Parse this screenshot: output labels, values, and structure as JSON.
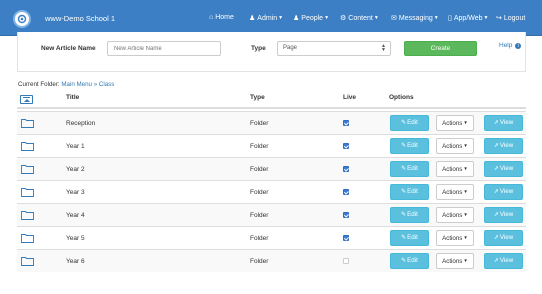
{
  "navbar": {
    "brand": "www-Demo School 1",
    "items": [
      {
        "icon": "home-icon",
        "glyph": "⌂",
        "label": "Home",
        "caret": false
      },
      {
        "icon": "user-icon",
        "glyph": "♟",
        "label": "Admin",
        "caret": true
      },
      {
        "icon": "users-icon",
        "glyph": "♟",
        "label": "People",
        "caret": true
      },
      {
        "icon": "gear-icon",
        "glyph": "⚙",
        "label": "Content",
        "caret": true
      },
      {
        "icon": "envelope-icon",
        "glyph": "✉",
        "label": "Messaging",
        "caret": true
      },
      {
        "icon": "mobile-icon",
        "glyph": "▯",
        "label": "App/Web",
        "caret": true
      },
      {
        "icon": "logout-icon",
        "glyph": "↪",
        "label": "Logout",
        "caret": false
      }
    ]
  },
  "create_panel": {
    "name_label": "New Article Name",
    "name_placeholder": "New Article Name",
    "type_label": "Type",
    "type_value": "Page",
    "create_label": "Create",
    "help_label": "Help"
  },
  "breadcrumb": {
    "prefix": "Current Folder:",
    "items": [
      "Main Menu",
      "Class"
    ],
    "separator": "»"
  },
  "table": {
    "headers": {
      "title": "Title",
      "type": "Type",
      "live": "Live",
      "options": "Options"
    },
    "rows": [
      {
        "title": "Reception",
        "type": "Folder",
        "live": true
      },
      {
        "title": "Year 1",
        "type": "Folder",
        "live": true
      },
      {
        "title": "Year 2",
        "type": "Folder",
        "live": true
      },
      {
        "title": "Year 3",
        "type": "Folder",
        "live": true
      },
      {
        "title": "Year 4",
        "type": "Folder",
        "live": true
      },
      {
        "title": "Year 5",
        "type": "Folder",
        "live": true
      },
      {
        "title": "Year 6",
        "type": "Folder",
        "live": false
      }
    ],
    "edit_label": "Edit",
    "actions_label": "Actions",
    "view_label": "View"
  },
  "colors": {
    "navbar": "#3c7fc4",
    "create": "#5cb85c",
    "info": "#5bc0de",
    "link": "#337ab7"
  }
}
